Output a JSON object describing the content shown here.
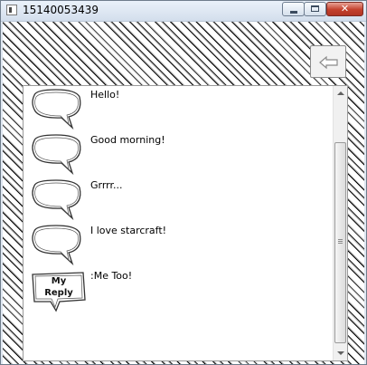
{
  "window": {
    "title": "15140053439"
  },
  "titlebar": {
    "close_glyph": "✕"
  },
  "toolbar": {
    "back_icon": "back-arrow-icon"
  },
  "chat": {
    "messages": [
      {
        "text": "Hello!",
        "bubble": "speech-bubble-icon"
      },
      {
        "text": "Good morning!",
        "bubble": "speech-bubble-icon"
      },
      {
        "text": "Grrrr...",
        "bubble": "speech-bubble-icon"
      },
      {
        "text": "I love starcraft!",
        "bubble": "speech-bubble-icon"
      },
      {
        "text": ":Me Too!",
        "bubble": "reply-bubble-icon",
        "bubble_label_line1": "My",
        "bubble_label_line2": "Reply"
      }
    ]
  }
}
